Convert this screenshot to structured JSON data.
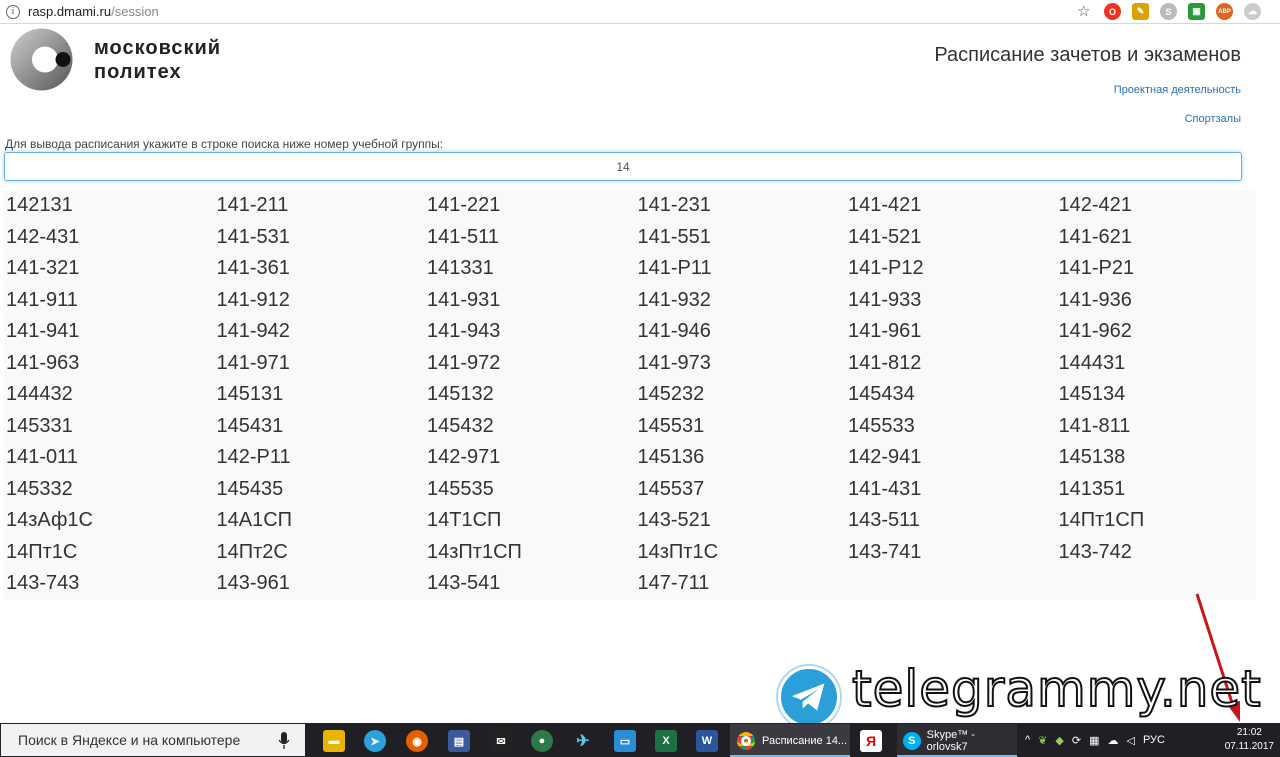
{
  "browser": {
    "url_host": "rasp.dmami.ru",
    "url_path": "/session"
  },
  "header": {
    "logo_line1": "московский",
    "logo_line2": "политех",
    "title": "Расписание зачетов и экзаменов",
    "links": [
      "Проектная деятельность",
      "Спортзалы"
    ]
  },
  "search": {
    "instruction": "Для вывода расписания укажите в строке поиска ниже номер учебной группы:",
    "value": "14"
  },
  "groups": [
    "142131",
    "141-211",
    "141-221",
    "141-231",
    "141-421",
    "142-421",
    "142-431",
    "141-531",
    "141-511",
    "141-551",
    "141-521",
    "141-621",
    "141-321",
    "141-361",
    "141331",
    "141-Р11",
    "141-Р12",
    "141-Р21",
    "141-911",
    "141-912",
    "141-931",
    "141-932",
    "141-933",
    "141-936",
    "141-941",
    "141-942",
    "141-943",
    "141-946",
    "141-961",
    "141-962",
    "141-963",
    "141-971",
    "141-972",
    "141-973",
    "141-812",
    "144431",
    "144432",
    "145131",
    "145132",
    "145232",
    "145434",
    "145134",
    "145331",
    "145431",
    "145432",
    "145531",
    "145533",
    "141-811",
    "141-011",
    "142-Р11",
    "142-971",
    "145136",
    "142-941",
    "145138",
    "145332",
    "145435",
    "145535",
    "145537",
    "141-431",
    "141351",
    "14зАф1С",
    "14А1СП",
    "14Т1СП",
    "143-521",
    "143-511",
    "14Пт1СП",
    "14Пт1С",
    "14Пт2С",
    "14зПт1СП",
    "14зПт1С",
    "143-741",
    "143-742",
    "143-743",
    "143-961",
    "143-541",
    "147-711"
  ],
  "watermark": "telegrammy.net",
  "taskbar": {
    "search_placeholder": "Поиск в Яндексе и на компьютере",
    "chrome_task": "Расписание 14...",
    "skype_task": "Skype™ - orlovsk7",
    "lang": "РУС",
    "time": "21:02",
    "date": "07.11.2017"
  }
}
